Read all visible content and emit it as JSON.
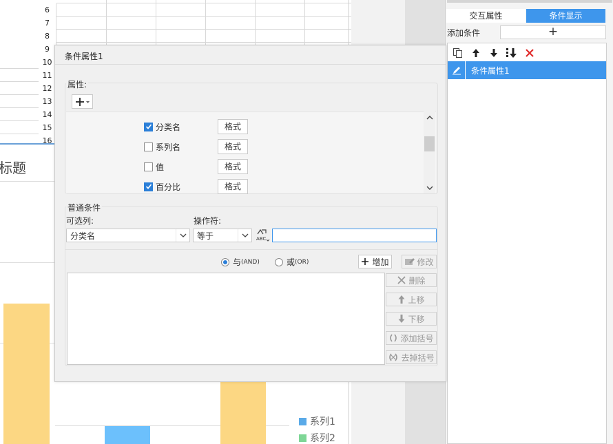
{
  "spreadsheet": {
    "row_numbers": [
      "6",
      "7",
      "8",
      "9",
      "10",
      "11",
      "12",
      "13",
      "14",
      "15",
      "16"
    ]
  },
  "chart": {
    "title_partial": "标题",
    "legend": [
      {
        "name": "系列1",
        "color": "#5aaae8"
      },
      {
        "name": "系列2",
        "color": "#7ed696"
      }
    ],
    "bar_colors": {
      "series_yellow": "#fcd783",
      "series_blue": "#6cc0fc"
    }
  },
  "right_panel": {
    "tabs": [
      {
        "label": "交互属性",
        "active": false
      },
      {
        "label": "条件显示",
        "active": true
      }
    ],
    "add_condition_label": "添加条件",
    "add_button_symbol": "+",
    "toolbar_icons": [
      "copy-icon",
      "arrow-up-icon",
      "arrow-down-icon",
      "move-bottom-icon",
      "delete-icon"
    ],
    "condition_items": [
      {
        "label": "条件属性1",
        "selected": true
      }
    ]
  },
  "dialog": {
    "title": "条件属性1",
    "property_group_label": "属性:",
    "properties": [
      {
        "label": "分类名",
        "checked": true,
        "format_label": "格式"
      },
      {
        "label": "系列名",
        "checked": false,
        "format_label": "格式"
      },
      {
        "label": "值",
        "checked": false,
        "format_label": "格式"
      },
      {
        "label": "百分比",
        "checked": true,
        "format_label": "格式"
      }
    ],
    "condition_group_label": "普通条件",
    "column_label": "可选列:",
    "column_value": "分类名",
    "operator_label": "操作符:",
    "operator_value": "等于",
    "value_input": "",
    "radio_and": {
      "label": "与",
      "sub": "(AND)",
      "selected": true
    },
    "radio_or": {
      "label": "或",
      "sub": "(OR)",
      "selected": false
    },
    "add_button": "增加",
    "modify_button": "修改",
    "side_buttons": {
      "delete": "删除",
      "move_up": "上移",
      "move_down": "下移",
      "add_bracket": "添加括号",
      "remove_bracket": "去掉括号"
    },
    "accent_color": "#3e96ec"
  }
}
